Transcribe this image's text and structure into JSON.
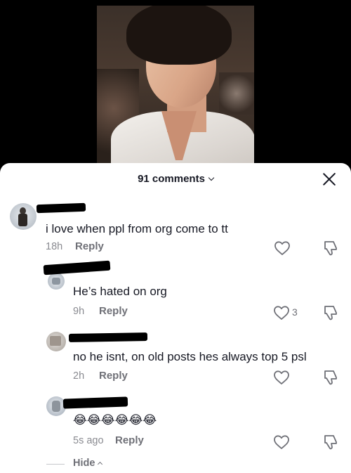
{
  "sheet": {
    "title": "91 comments"
  },
  "comments": [
    {
      "text": "i love when ppl from org come to tt",
      "time": "18h",
      "reply_label": "Reply",
      "likes": ""
    },
    {
      "text": "He’s hated on org",
      "time": "9h",
      "reply_label": "Reply",
      "likes": "3"
    },
    {
      "text": "no he isnt, on old posts hes always top 5 psl",
      "time": "2h",
      "reply_label": "Reply",
      "likes": ""
    },
    {
      "text": "😂😂😂😂😂😂",
      "time": "5s ago",
      "reply_label": "Reply",
      "likes": ""
    }
  ],
  "footer": {
    "hide_label": "Hide"
  },
  "icons": {
    "heart": "heart-outline-icon",
    "dislike": "thumbs-down-icon",
    "close": "close-icon",
    "chevron": "chevron-down-icon"
  }
}
